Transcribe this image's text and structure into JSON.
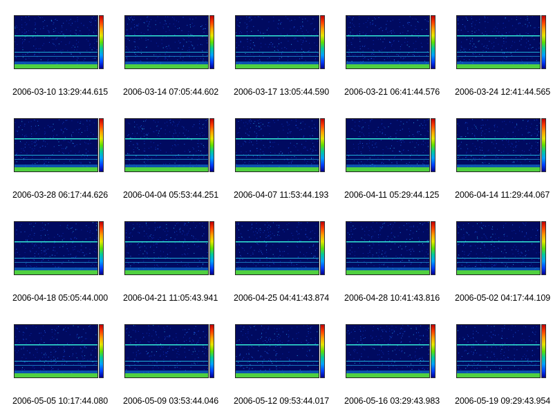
{
  "captions": [
    "2006-03-10 13:29:44.615",
    "2006-03-14 07:05:44.602",
    "2006-03-17 13:05:44.590",
    "2006-03-21 06:41:44.576",
    "2006-03-24 12:41:44.565",
    "2006-03-28 06:17:44.626",
    "2006-04-04 05:53:44.251",
    "2006-04-07 11:53:44.193",
    "2006-04-11 05:29:44.125",
    "2006-04-14 11:29:44.067",
    "2006-04-18 05:05:44.000",
    "2006-04-21 11:05:43.941",
    "2006-04-25 04:41:43.874",
    "2006-04-28 10:41:43.816",
    "2006-05-02 04:17:44.109",
    "2006-05-05 10:17:44.080",
    "2006-05-09 03:53:44.046",
    "2006-05-12 09:53:44.017",
    "2006-05-16 03:29:43.983",
    "2006-05-19 09:29:43.954"
  ],
  "colors": {
    "background": "#ffffff",
    "spectrogram_bg": "#000a60",
    "band": "#30e0d0",
    "floor": "#50d040"
  }
}
